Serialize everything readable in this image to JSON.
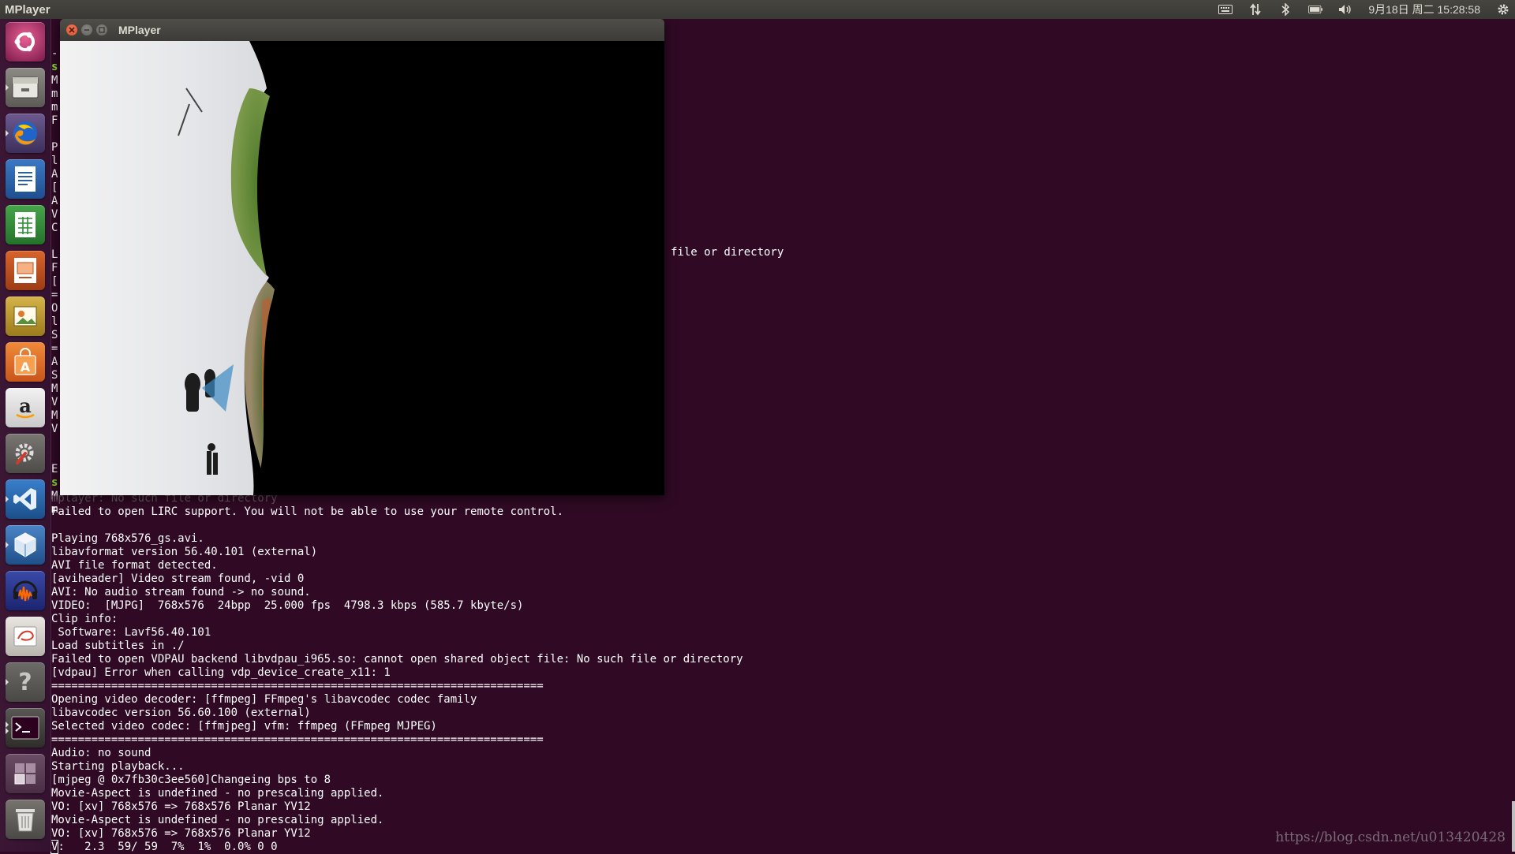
{
  "top_panel": {
    "app_name": "MPlayer",
    "clock": "9月18日 周二 15:28:58"
  },
  "launcher": {
    "items": [
      {
        "name": "dash-home",
        "label": "Dash"
      },
      {
        "name": "files",
        "label": "Files"
      },
      {
        "name": "firefox",
        "label": "Firefox"
      },
      {
        "name": "writer",
        "label": "LibreOffice Writer"
      },
      {
        "name": "calc",
        "label": "LibreOffice Calc"
      },
      {
        "name": "impress",
        "label": "LibreOffice Impress"
      },
      {
        "name": "image-viewer",
        "label": "Image Viewer"
      },
      {
        "name": "software-center",
        "label": "Ubuntu Software"
      },
      {
        "name": "amazon",
        "label": "Amazon"
      },
      {
        "name": "system-settings",
        "label": "System Settings"
      },
      {
        "name": "vscode",
        "label": "Visual Studio Code"
      },
      {
        "name": "virtualbox",
        "label": "VirtualBox"
      },
      {
        "name": "audacity",
        "label": "Audacity"
      },
      {
        "name": "editor",
        "label": "Text Editor"
      },
      {
        "name": "help",
        "label": "Help"
      },
      {
        "name": "terminal",
        "label": "Terminal"
      },
      {
        "name": "workspaces",
        "label": "Workspaces"
      },
      {
        "name": "trash",
        "label": "Trash"
      }
    ]
  },
  "mplayer_window": {
    "title": "MPlayer"
  },
  "terminal": {
    "left_column_chars": [
      "-",
      "s",
      "M",
      "m",
      "m",
      "F",
      "",
      "P",
      "l",
      "A",
      "[",
      "A",
      "V",
      "C",
      "",
      "L",
      "F",
      "[",
      "=",
      "O",
      "l",
      "S",
      "=",
      "A",
      "S",
      "M",
      "V",
      "M",
      "V",
      "",
      "",
      "E",
      "s",
      "M",
      "m"
    ],
    "peek_text": "file or directory",
    "lines": [
      "mplayer: No such file or directory",
      "Failed to open LIRC support. You will not be able to use your remote control.",
      "",
      "Playing 768x576_gs.avi.",
      "libavformat version 56.40.101 (external)",
      "AVI file format detected.",
      "[aviheader] Video stream found, -vid 0",
      "AVI: No audio stream found -> no sound.",
      "VIDEO:  [MJPG]  768x576  24bpp  25.000 fps  4798.3 kbps (585.7 kbyte/s)",
      "Clip info:",
      " Software: Lavf56.40.101",
      "Load subtitles in ./",
      "Failed to open VDPAU backend libvdpau_i965.so: cannot open shared object file: No such file or directory",
      "[vdpau] Error when calling vdp_device_create_x11: 1",
      "==========================================================================",
      "Opening video decoder: [ffmpeg] FFmpeg's libavcodec codec family",
      "libavcodec version 56.60.100 (external)",
      "Selected video codec: [ffmjpeg] vfm: ffmpeg (FFmpeg MJPEG)",
      "==========================================================================",
      "Audio: no sound",
      "Starting playback...",
      "[mjpeg @ 0x7fb30c3ee560]Changeing bps to 8",
      "Movie-Aspect is undefined - no prescaling applied.",
      "VO: [xv] 768x576 => 768x576 Planar YV12",
      "Movie-Aspect is undefined - no prescaling applied.",
      "VO: [xv] 768x576 => 768x576 Planar YV12"
    ],
    "status_cursor_char": "V",
    "status_line_rest": ":   2.3  59/ 59  7%  1%  0.0% 0 0"
  },
  "watermark": "https://blog.csdn.net/u013420428",
  "colors": {
    "terminal_bg": "#300a24",
    "panel_bg": "#3c3b37",
    "close_button": "#e0532f",
    "prompt_green": "#8ae234"
  }
}
